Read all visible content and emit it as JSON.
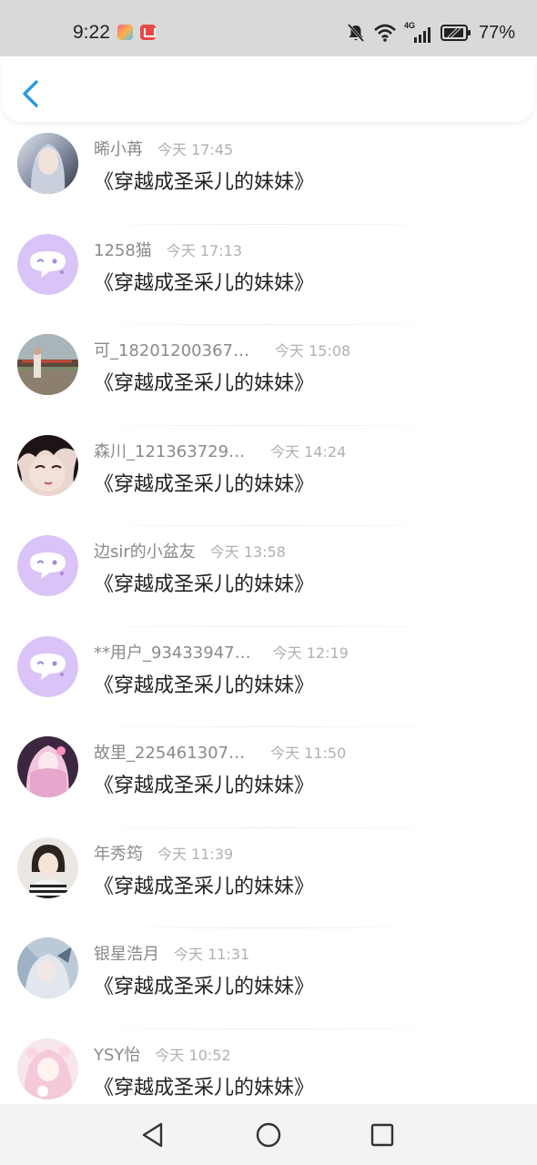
{
  "status_bar": {
    "time": "9:22",
    "network": "4G",
    "battery": "77%",
    "icons": [
      "silent-bell-icon",
      "wifi-icon",
      "signal-icon",
      "battery-icon"
    ]
  },
  "header": {
    "back_icon": "chevron-left-icon",
    "accent": "#2a9ae0"
  },
  "list": [
    {
      "user": "晞小苒",
      "time": "今天 17:45",
      "content": "《穿越成圣采儿的妹妹》",
      "avatar": "photo-anime-girl-silver-hair"
    },
    {
      "user": "1258猫",
      "time": "今天 17:13",
      "content": "《穿越成圣采儿的妹妹》",
      "avatar": "default-chat-bubble"
    },
    {
      "user": "可_18201200367…",
      "time": "今天 15:08",
      "content": "《穿越成圣采儿的妹妹》",
      "avatar": "photo-outdoor"
    },
    {
      "user": "森川_121363729…",
      "time": "今天 14:24",
      "content": "《穿越成圣采儿的妹妹》",
      "avatar": "photo-anime-dark-hair"
    },
    {
      "user": "边sir的小盆友",
      "time": "今天 13:58",
      "content": "《穿越成圣采儿的妹妹》",
      "avatar": "default-chat-bubble"
    },
    {
      "user": "**用户_93433947…",
      "time": "今天 12:19",
      "content": "《穿越成圣采儿的妹妹》",
      "avatar": "default-chat-bubble"
    },
    {
      "user": "故里_225461307…",
      "time": "今天 11:50",
      "content": "《穿越成圣采儿的妹妹》",
      "avatar": "photo-anime-pink"
    },
    {
      "user": "年秀筠",
      "time": "今天 11:39",
      "content": "《穿越成圣采儿的妹妹》",
      "avatar": "photo-girl-striped"
    },
    {
      "user": "银星浩月",
      "time": "今天 11:31",
      "content": "《穿越成圣采儿的妹妹》",
      "avatar": "photo-anime-silver"
    },
    {
      "user": "YSY怡",
      "time": "今天 10:52",
      "content": "《穿越成圣采儿的妹妹》",
      "avatar": "photo-anime-pastel"
    }
  ],
  "nav": [
    "back-triangle-icon",
    "home-circle-icon",
    "recents-square-icon"
  ]
}
